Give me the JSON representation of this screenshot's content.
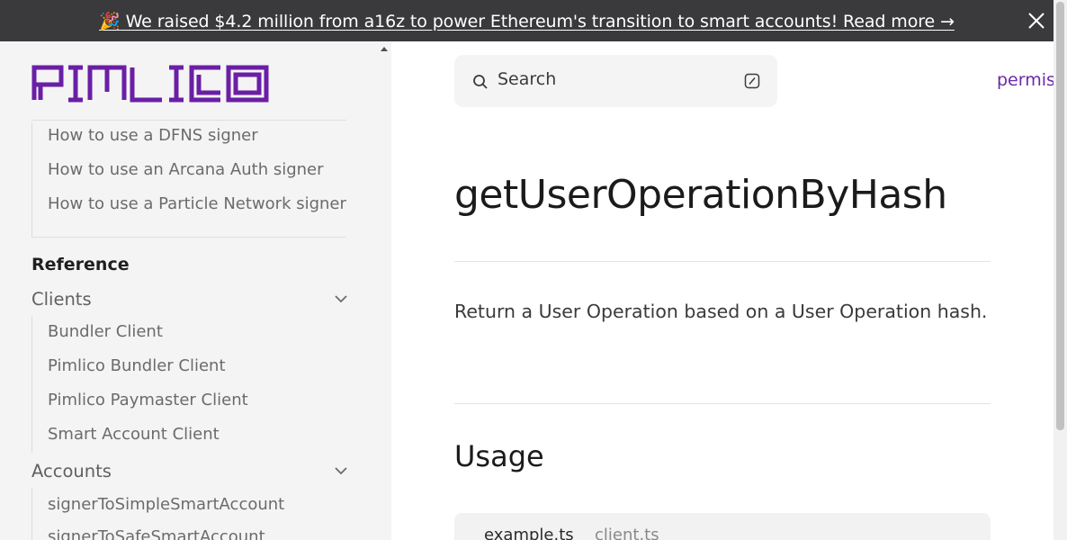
{
  "banner": {
    "emoji": "🎉",
    "text": "We raised $4.2 million from a16z to power Ethereum's transition to smart accounts! Read more →",
    "close_icon": "close-icon"
  },
  "brand": {
    "logo_text": "PIMLICO",
    "color": "#6a1fa6"
  },
  "sidebar": {
    "top_items": [
      "How to use a DFNS signer",
      "How to use an Arcana Auth signer",
      "How to use a Particle Network signer"
    ],
    "section_title": "Reference",
    "groups": [
      {
        "label": "Clients",
        "items": [
          "Bundler Client",
          "Pimlico Bundler Client",
          "Pimlico Paymaster Client",
          "Smart Account Client"
        ]
      },
      {
        "label": "Accounts",
        "items": [
          "signerToSimpleSmartAccount",
          "signerToSafeSmartAccount"
        ]
      }
    ]
  },
  "search": {
    "label": "Search",
    "icon": "search-icon",
    "shortcut_icon": "slash-key-icon"
  },
  "top_nav": {
    "link": "permis"
  },
  "content": {
    "title": "getUserOperationByHash",
    "description": "Return a User Operation based on a User Operation hash.",
    "usage_heading": "Usage",
    "code_tabs": [
      "example.ts",
      "client.ts"
    ]
  }
}
